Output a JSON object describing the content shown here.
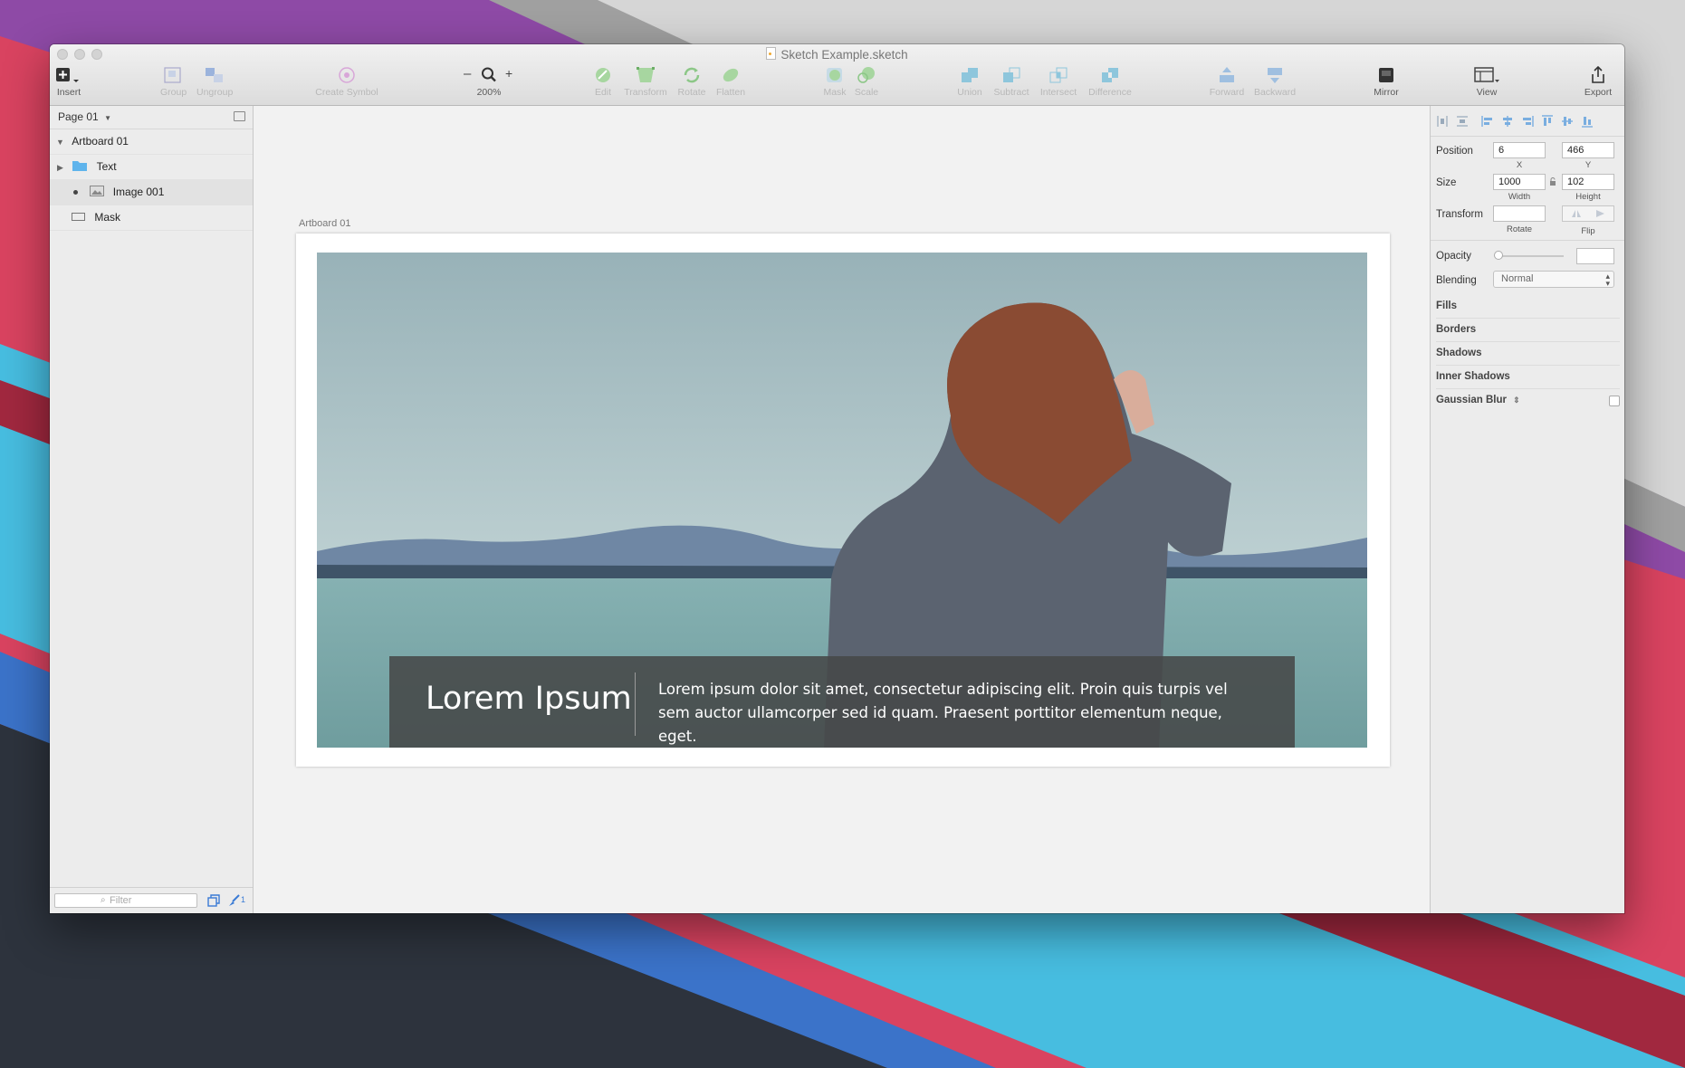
{
  "window": {
    "title": "Sketch Example.sketch"
  },
  "toolbar": {
    "insert": "Insert",
    "group": "Group",
    "ungroup": "Ungroup",
    "create_symbol": "Create Symbol",
    "zoom_minus": "–",
    "zoom_plus": "+",
    "zoom_level": "200%",
    "edit": "Edit",
    "transform": "Transform",
    "rotate": "Rotate",
    "flatten": "Flatten",
    "mask": "Mask",
    "scale": "Scale",
    "union": "Union",
    "subtract": "Subtract",
    "intersect": "Intersect",
    "difference": "Difference",
    "forward": "Forward",
    "backward": "Backward",
    "mirror": "Mirror",
    "view": "View",
    "export": "Export"
  },
  "layers": {
    "page": "Page 01",
    "items": [
      {
        "label": "Artboard 01"
      },
      {
        "label": "Text"
      },
      {
        "label": "Image 001"
      },
      {
        "label": "Mask"
      }
    ],
    "filter_placeholder": "Filter",
    "badge_count": "1"
  },
  "canvas": {
    "artboard_label": "Artboard 01",
    "caption_title": "Lorem Ipsum",
    "caption_body": "Lorem ipsum dolor sit amet, consectetur adipiscing elit. Proin quis turpis vel sem auctor ullamcorper sed id quam. Praesent porttitor elementum neque, eget."
  },
  "inspector": {
    "position_label": "Position",
    "x_value": "6",
    "y_value": "466",
    "x_label": "X",
    "y_label": "Y",
    "size_label": "Size",
    "width_value": "1000",
    "height_value": "102",
    "width_label": "Width",
    "height_label": "Height",
    "transform_label": "Transform",
    "rotate_label": "Rotate",
    "flip_label": "Flip",
    "opacity_label": "Opacity",
    "blending_label": "Blending",
    "blending_value": "Normal",
    "sections": [
      "Fills",
      "Borders",
      "Shadows",
      "Inner Shadows",
      "Gaussian Blur"
    ]
  },
  "colors": {
    "accent": "#4a90d9",
    "wallpaper_purple": "#8e4aa6",
    "wallpaper_red": "#e0435b",
    "wallpaper_cyan": "#47bde0",
    "wallpaper_dark": "#2d333d",
    "folder_blue": "#5fb4ec"
  }
}
